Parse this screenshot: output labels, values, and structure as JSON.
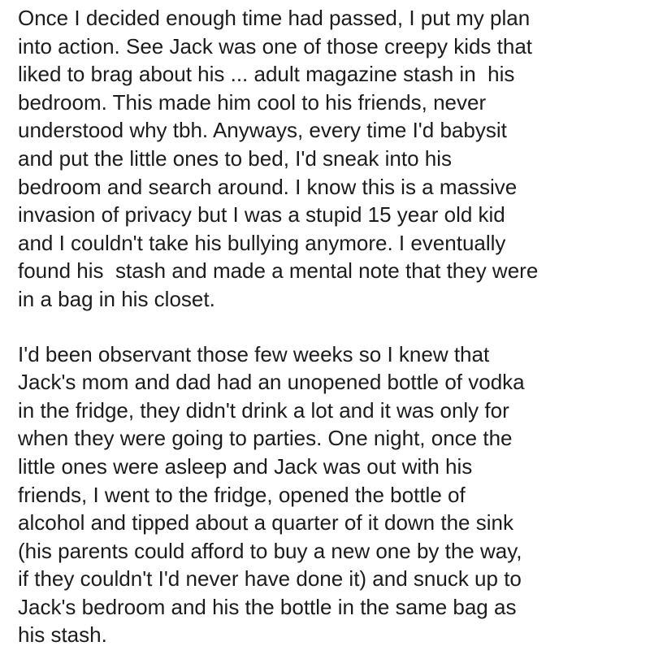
{
  "post": {
    "paragraphs": [
      {
        "lines": [
          "Once I decided enough time had passed, I put my plan",
          "into action. See Jack was one of those creepy kids that",
          "liked to brag about his ... adult magazine stash in  his",
          "bedroom. This made him cool to his friends, never",
          "understood why tbh. Anyways, every time I'd babysit",
          "and put the little ones to bed, I'd sneak into his",
          "bedroom and search around. I know this is a massive",
          "invasion of privacy but I was a stupid 15 year old kid",
          "and I couldn't take his bullying anymore. I eventually",
          "found his  stash and made a mental note that they were",
          "in a bag in his closet."
        ]
      },
      {
        "lines": [
          "I'd been observant those few weeks so I knew that",
          "Jack's mom and dad had an unopened bottle of vodka",
          "in the fridge, they didn't drink a lot and it was only for",
          "when they were going to parties. One night, once the",
          "little ones were asleep and Jack was out with his",
          "friends, I went to the fridge, opened the bottle of",
          "alcohol and tipped about a quarter of it down the sink",
          "(his parents could afford to buy a new one by the way,",
          "if they couldn't I'd never have done it) and snuck up to",
          "Jack's bedroom and his the bottle in the same bag as",
          "his stash."
        ]
      }
    ]
  }
}
